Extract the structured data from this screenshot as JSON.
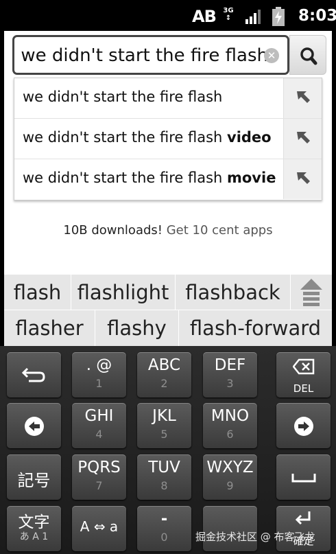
{
  "status_bar": {
    "input_indicator": "AB",
    "network": "3G",
    "time": "8:03"
  },
  "search": {
    "query": "we didn't start the fire flash",
    "query_visible": "we didn't start the fire flash",
    "clear_icon": "clear-icon",
    "search_icon": "search-icon"
  },
  "suggestions": [
    {
      "base": "we didn't start the fire flash",
      "bold": ""
    },
    {
      "base": "we didn't start the fire flash ",
      "bold": "video"
    },
    {
      "base": "we didn't start the fire flash ",
      "bold": "movie"
    }
  ],
  "ad": {
    "text": "10B downloads!",
    "link": "Get 10 cent apps"
  },
  "candidates": {
    "row1": [
      "flash",
      "flashlight",
      "flashback"
    ],
    "row2": [
      "flasher",
      "flashy",
      "flash-forward"
    ]
  },
  "keyboard": {
    "keys": [
      {
        "main": ". @",
        "sub": "1"
      },
      {
        "main": "ABC",
        "sub": "2"
      },
      {
        "main": "DEF",
        "sub": "3"
      },
      {
        "main": "GHI",
        "sub": "4"
      },
      {
        "main": "JKL",
        "sub": "5"
      },
      {
        "main": "MNO",
        "sub": "6"
      },
      {
        "main": "PQRS",
        "sub": "7"
      },
      {
        "main": "TUV",
        "sub": "8"
      },
      {
        "main": "WXYZ",
        "sub": "9"
      },
      {
        "main": "-",
        "sub": "0"
      }
    ],
    "del_label": "DEL",
    "symbols_label": "記号",
    "mode_label": "文字",
    "mode_sub": "あ A 1",
    "case_label": "A ⇔ a",
    "enter_label": "確定"
  },
  "watermark": "掘金技术社区 @ 布客飞龙"
}
